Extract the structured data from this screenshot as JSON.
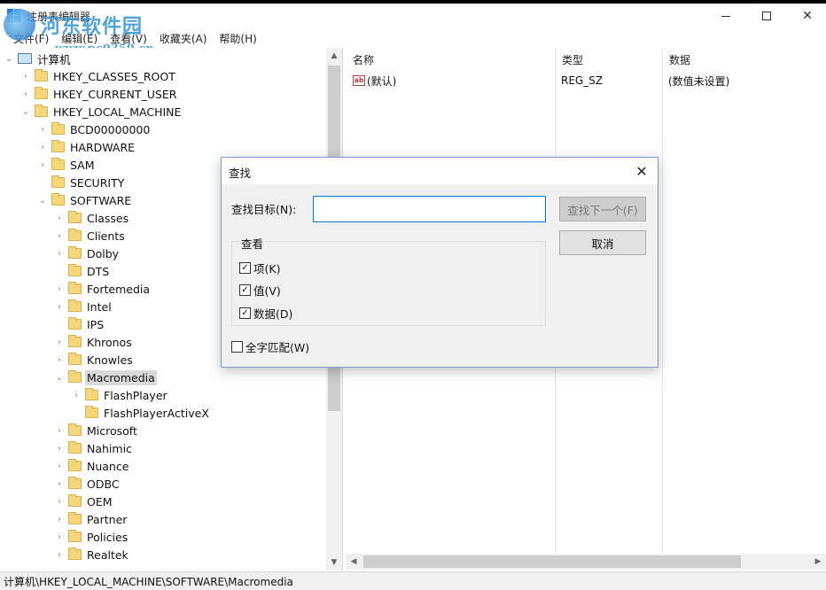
{
  "window": {
    "title": "注册表编辑器"
  },
  "watermark": {
    "brand": "河东软件园",
    "url": "www.pc0359.cn"
  },
  "menu": {
    "items": [
      "文件(F)",
      "编辑(E)",
      "查看(V)",
      "收藏夹(A)",
      "帮助(H)"
    ]
  },
  "tree": {
    "root": "计算机",
    "items": [
      {
        "label": "HKEY_CLASSES_ROOT",
        "level": 1,
        "expander": "collapsed"
      },
      {
        "label": "HKEY_CURRENT_USER",
        "level": 1,
        "expander": "collapsed"
      },
      {
        "label": "HKEY_LOCAL_MACHINE",
        "level": 1,
        "expander": "expanded"
      },
      {
        "label": "BCD00000000",
        "level": 2,
        "expander": "collapsed"
      },
      {
        "label": "HARDWARE",
        "level": 2,
        "expander": "collapsed"
      },
      {
        "label": "SAM",
        "level": 2,
        "expander": "collapsed"
      },
      {
        "label": "SECURITY",
        "level": 2,
        "expander": "none"
      },
      {
        "label": "SOFTWARE",
        "level": 2,
        "expander": "expanded"
      },
      {
        "label": "Classes",
        "level": 3,
        "expander": "collapsed"
      },
      {
        "label": "Clients",
        "level": 3,
        "expander": "collapsed"
      },
      {
        "label": "Dolby",
        "level": 3,
        "expander": "collapsed"
      },
      {
        "label": "DTS",
        "level": 3,
        "expander": "none"
      },
      {
        "label": "Fortemedia",
        "level": 3,
        "expander": "collapsed"
      },
      {
        "label": "Intel",
        "level": 3,
        "expander": "collapsed"
      },
      {
        "label": "IPS",
        "level": 3,
        "expander": "none"
      },
      {
        "label": "Khronos",
        "level": 3,
        "expander": "collapsed"
      },
      {
        "label": "Knowles",
        "level": 3,
        "expander": "collapsed"
      },
      {
        "label": "Macromedia",
        "level": 3,
        "expander": "expanded",
        "selected": true
      },
      {
        "label": "FlashPlayer",
        "level": 4,
        "expander": "collapsed"
      },
      {
        "label": "FlashPlayerActiveX",
        "level": 4,
        "expander": "none"
      },
      {
        "label": "Microsoft",
        "level": 3,
        "expander": "collapsed"
      },
      {
        "label": "Nahimic",
        "level": 3,
        "expander": "collapsed"
      },
      {
        "label": "Nuance",
        "level": 3,
        "expander": "collapsed"
      },
      {
        "label": "ODBC",
        "level": 3,
        "expander": "collapsed"
      },
      {
        "label": "OEM",
        "level": 3,
        "expander": "collapsed"
      },
      {
        "label": "Partner",
        "level": 3,
        "expander": "collapsed"
      },
      {
        "label": "Policies",
        "level": 3,
        "expander": "collapsed"
      },
      {
        "label": "Realtek",
        "level": 3,
        "expander": "collapsed"
      }
    ]
  },
  "list": {
    "columns": [
      "名称",
      "类型",
      "数据"
    ],
    "rows": [
      {
        "name": "(默认)",
        "type": "REG_SZ",
        "data": "(数值未设置)"
      }
    ]
  },
  "status": {
    "path": "计算机\\HKEY_LOCAL_MACHINE\\SOFTWARE\\Macromedia"
  },
  "dialog": {
    "title": "查找",
    "find_label": "查找目标(N):",
    "find_value": "",
    "find_next_label": "查找下一个(F)",
    "cancel_label": "取消",
    "look_group_title": "查看",
    "options": [
      {
        "label": "项(K)",
        "checked": true
      },
      {
        "label": "值(V)",
        "checked": true
      },
      {
        "label": "数据(D)",
        "checked": true
      }
    ],
    "match_whole": {
      "label": "全字匹配(W)",
      "checked": false
    }
  }
}
